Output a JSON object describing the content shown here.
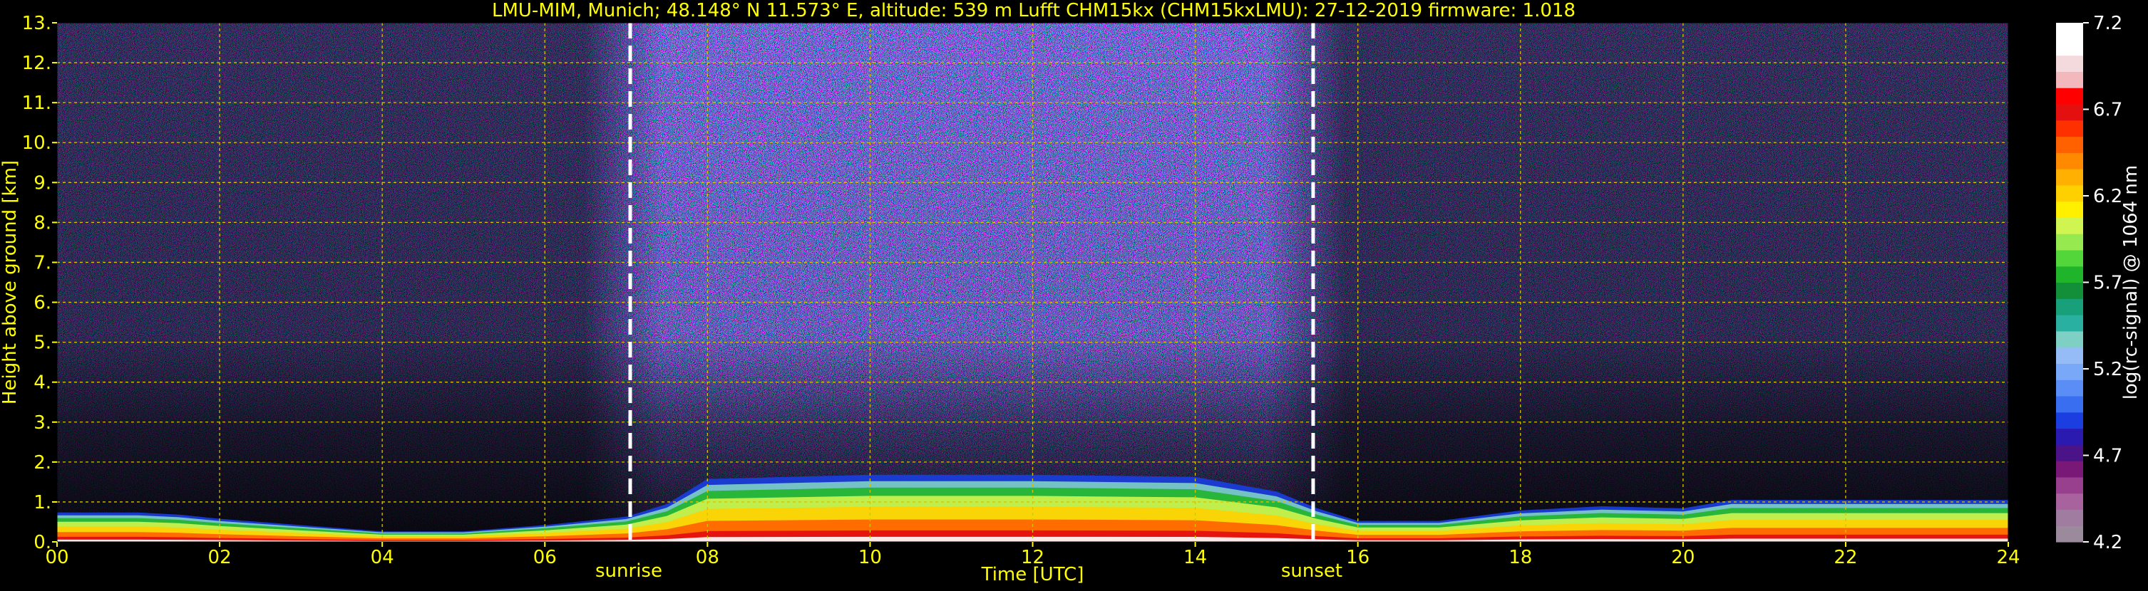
{
  "chart_data": {
    "type": "heatmap",
    "title": "LMU-MIM, Munich; 48.148° N 11.573° E, altitude: 539 m    Lufft CHM15kx (CHM15kxLMU): 27-12-2019    firmware: 1.018",
    "xlabel": "Time [UTC]",
    "ylabel": "Height above ground [km]",
    "xlim": [
      0,
      24
    ],
    "ylim": [
      0,
      13
    ],
    "x_ticks": [
      "00",
      "02",
      "04",
      "06",
      "08",
      "10",
      "12",
      "14",
      "16",
      "18",
      "20",
      "22",
      "24"
    ],
    "y_ticks": [
      "0.",
      "1.",
      "2.",
      "3.",
      "4.",
      "5.",
      "6.",
      "7.",
      "8.",
      "9.",
      "10.",
      "11.",
      "12.",
      "13."
    ],
    "grid": true,
    "markers": [
      {
        "label": "sunrise",
        "x": 7.05
      },
      {
        "label": "sunset",
        "x": 15.45
      }
    ],
    "colorbar": {
      "label": "log(rc-signal) @ 1064 nm",
      "range": [
        4.2,
        7.2
      ],
      "ticks": [
        "4.2",
        "4.7",
        "5.2",
        "5.7",
        "6.2",
        "6.7",
        "7.2"
      ],
      "colors": [
        "#9a8a9c",
        "#a07ca0",
        "#a8629e",
        "#98408e",
        "#7a1878",
        "#4a1488",
        "#2a1ab0",
        "#1a3ee0",
        "#3a6ef0",
        "#5a8ef6",
        "#7aa8f8",
        "#96bcf8",
        "#7fd0c4",
        "#2ab0a0",
        "#17a07a",
        "#138f3a",
        "#1fb42a",
        "#52d63a",
        "#96ea50",
        "#d0f450",
        "#fff000",
        "#ffd000",
        "#ffb000",
        "#ff8a00",
        "#ff6000",
        "#ff3000",
        "#e41010",
        "#ff0000",
        "#f2b8bc",
        "#f4dadc",
        "#ffffff",
        "#ffffff"
      ]
    },
    "layers": [
      {
        "name": "noise",
        "x_range": [
          0,
          24
        ],
        "height_km": [
          0,
          13
        ]
      },
      {
        "name": "boundary_layer",
        "x": [
          0,
          1,
          1.5,
          2,
          3,
          4,
          5,
          6,
          7,
          7.5,
          8,
          10,
          12,
          14,
          15,
          15.5,
          16,
          17,
          18,
          19,
          20,
          20.6,
          22,
          24
        ],
        "top_km": [
          0.7,
          0.7,
          0.65,
          0.55,
          0.4,
          0.25,
          0.25,
          0.4,
          0.6,
          0.9,
          1.5,
          1.6,
          1.6,
          1.55,
          1.2,
          0.8,
          0.5,
          0.5,
          0.75,
          0.85,
          0.8,
          1.0,
          1.0,
          1.0
        ]
      }
    ]
  }
}
